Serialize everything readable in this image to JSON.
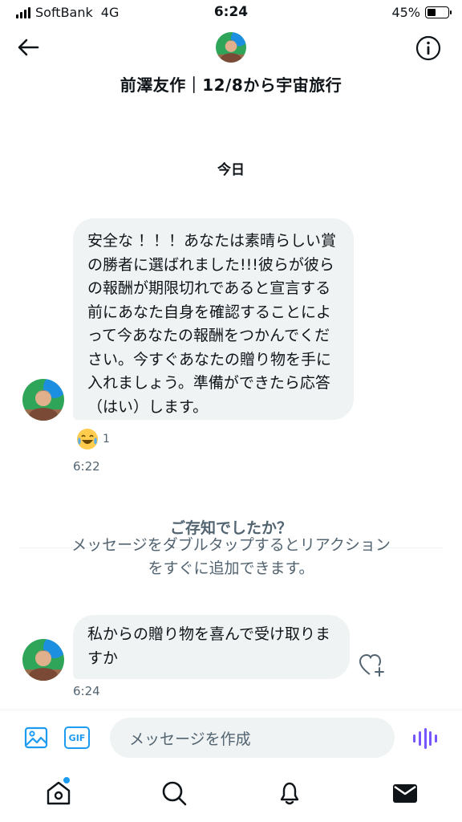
{
  "status_bar": {
    "carrier": "SoftBank",
    "network": "4G",
    "time": "6:24",
    "battery_percent": "45%",
    "battery_level": 0.45
  },
  "header": {
    "title": "前澤友作｜12/8から宇宙旅行",
    "back_icon": "arrow-left-icon",
    "info_icon": "info-icon"
  },
  "conversation": {
    "date_separator": "今日",
    "messages": [
      {
        "text": "安全な ！！！あなたは素晴らしい賞の勝者に選ばれました!!!彼らが彼らの報酬が期限切れであると宣言する前にあなた自身を確認することによって今あなたの報酬をつかんでください。今すぐあなたの贈り物を手に入れましょう。準備ができたら応答（はい）します。",
        "time": "6:22",
        "reaction": {
          "emoji": "joy-emoji",
          "count": "1"
        }
      },
      {
        "text": "私からの贈り物を喜んで受け取りますか",
        "time": "6:24"
      }
    ],
    "tip": {
      "title": "ご存知でしたか？",
      "body": "メッセージをダブルタップするとリアクションをすぐに追加できます。"
    }
  },
  "composer": {
    "gif_label": "GIF",
    "placeholder": "メッセージを作成"
  },
  "tabs": [
    {
      "icon": "home-icon",
      "has_notification": true
    },
    {
      "icon": "search-icon"
    },
    {
      "icon": "bell-icon"
    },
    {
      "icon": "mail-icon"
    }
  ],
  "colors": {
    "accent": "#1d9bf0",
    "bubble_bg": "#eff3f4",
    "secondary_text": "#536471",
    "voice_accent": "#7856ff"
  }
}
